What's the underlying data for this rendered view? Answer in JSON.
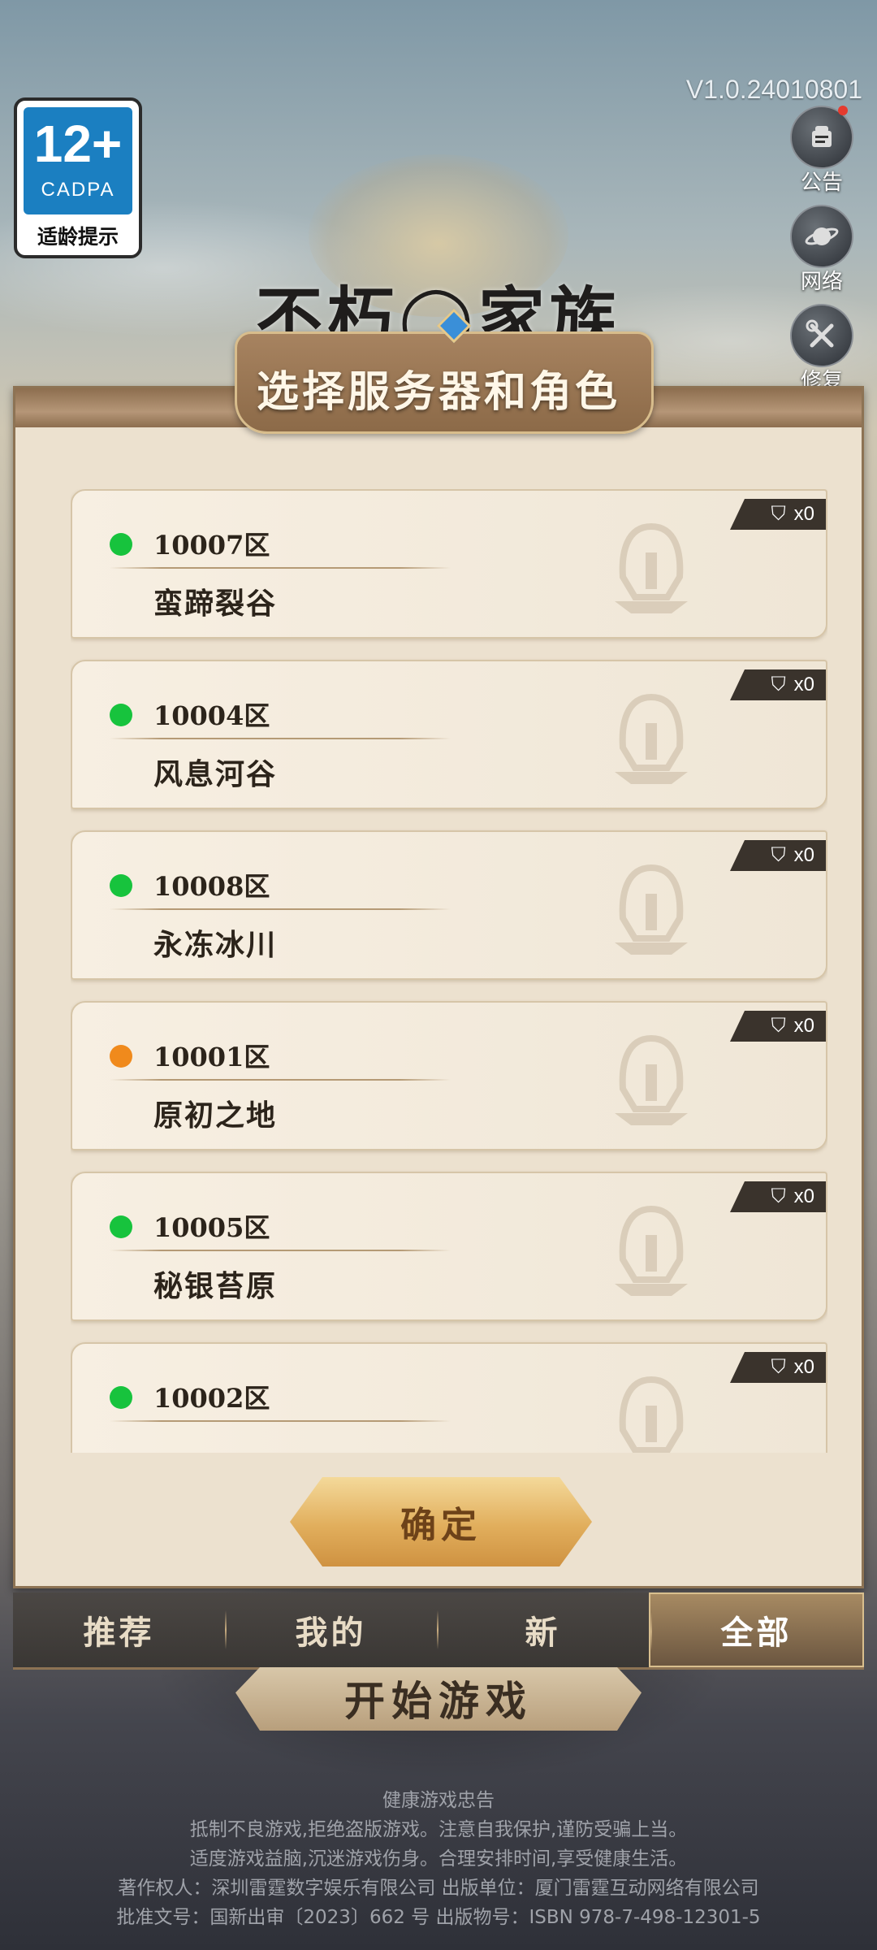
{
  "age_rating": {
    "number": "12+",
    "org": "CADPA",
    "label": "适龄提示"
  },
  "version": "V1.0.24010801",
  "side_buttons": [
    {
      "label": "公告",
      "icon": "announcement-icon",
      "has_badge": true
    },
    {
      "label": "网络",
      "icon": "network-planet-icon",
      "has_badge": false
    },
    {
      "label": "修复",
      "icon": "repair-tools-icon",
      "has_badge": false
    }
  ],
  "logo_text": "不朽◯家族",
  "panel": {
    "title": "选择服务器和角色",
    "servers": [
      {
        "id": "10007区",
        "name": "蛮蹄裂谷",
        "status": "green",
        "count": "x0"
      },
      {
        "id": "10004区",
        "name": "风息河谷",
        "status": "green",
        "count": "x0"
      },
      {
        "id": "10008区",
        "name": "永冻冰川",
        "status": "green",
        "count": "x0"
      },
      {
        "id": "10001区",
        "name": "原初之地",
        "status": "orange",
        "count": "x0"
      },
      {
        "id": "10005区",
        "name": "秘银苔原",
        "status": "green",
        "count": "x0"
      },
      {
        "id": "10002区",
        "name": "",
        "status": "green",
        "count": "x0"
      }
    ],
    "confirm_label": "确定"
  },
  "tabs": [
    {
      "label": "推荐",
      "active": false
    },
    {
      "label": "我的",
      "active": false
    },
    {
      "label": "新",
      "active": false
    },
    {
      "label": "全部",
      "active": true
    }
  ],
  "start_label": "开始游戏",
  "footer": {
    "title": "健康游戏忠告",
    "line1": "抵制不良游戏,拒绝盗版游戏。注意自我保护,谨防受骗上当。",
    "line2": "适度游戏益脑,沉迷游戏伤身。合理安排时间,享受健康生活。",
    "line3": "著作权人：深圳雷霆数字娱乐有限公司 出版单位：厦门雷霆互动网络有限公司",
    "line4": "批准文号：国新出审〔2023〕662 号 出版物号：ISBN 978-7-498-12301-5"
  },
  "colors": {
    "online": "#17c33d",
    "busy": "#f08a1c",
    "accent_gold": "#e1ae5c"
  }
}
